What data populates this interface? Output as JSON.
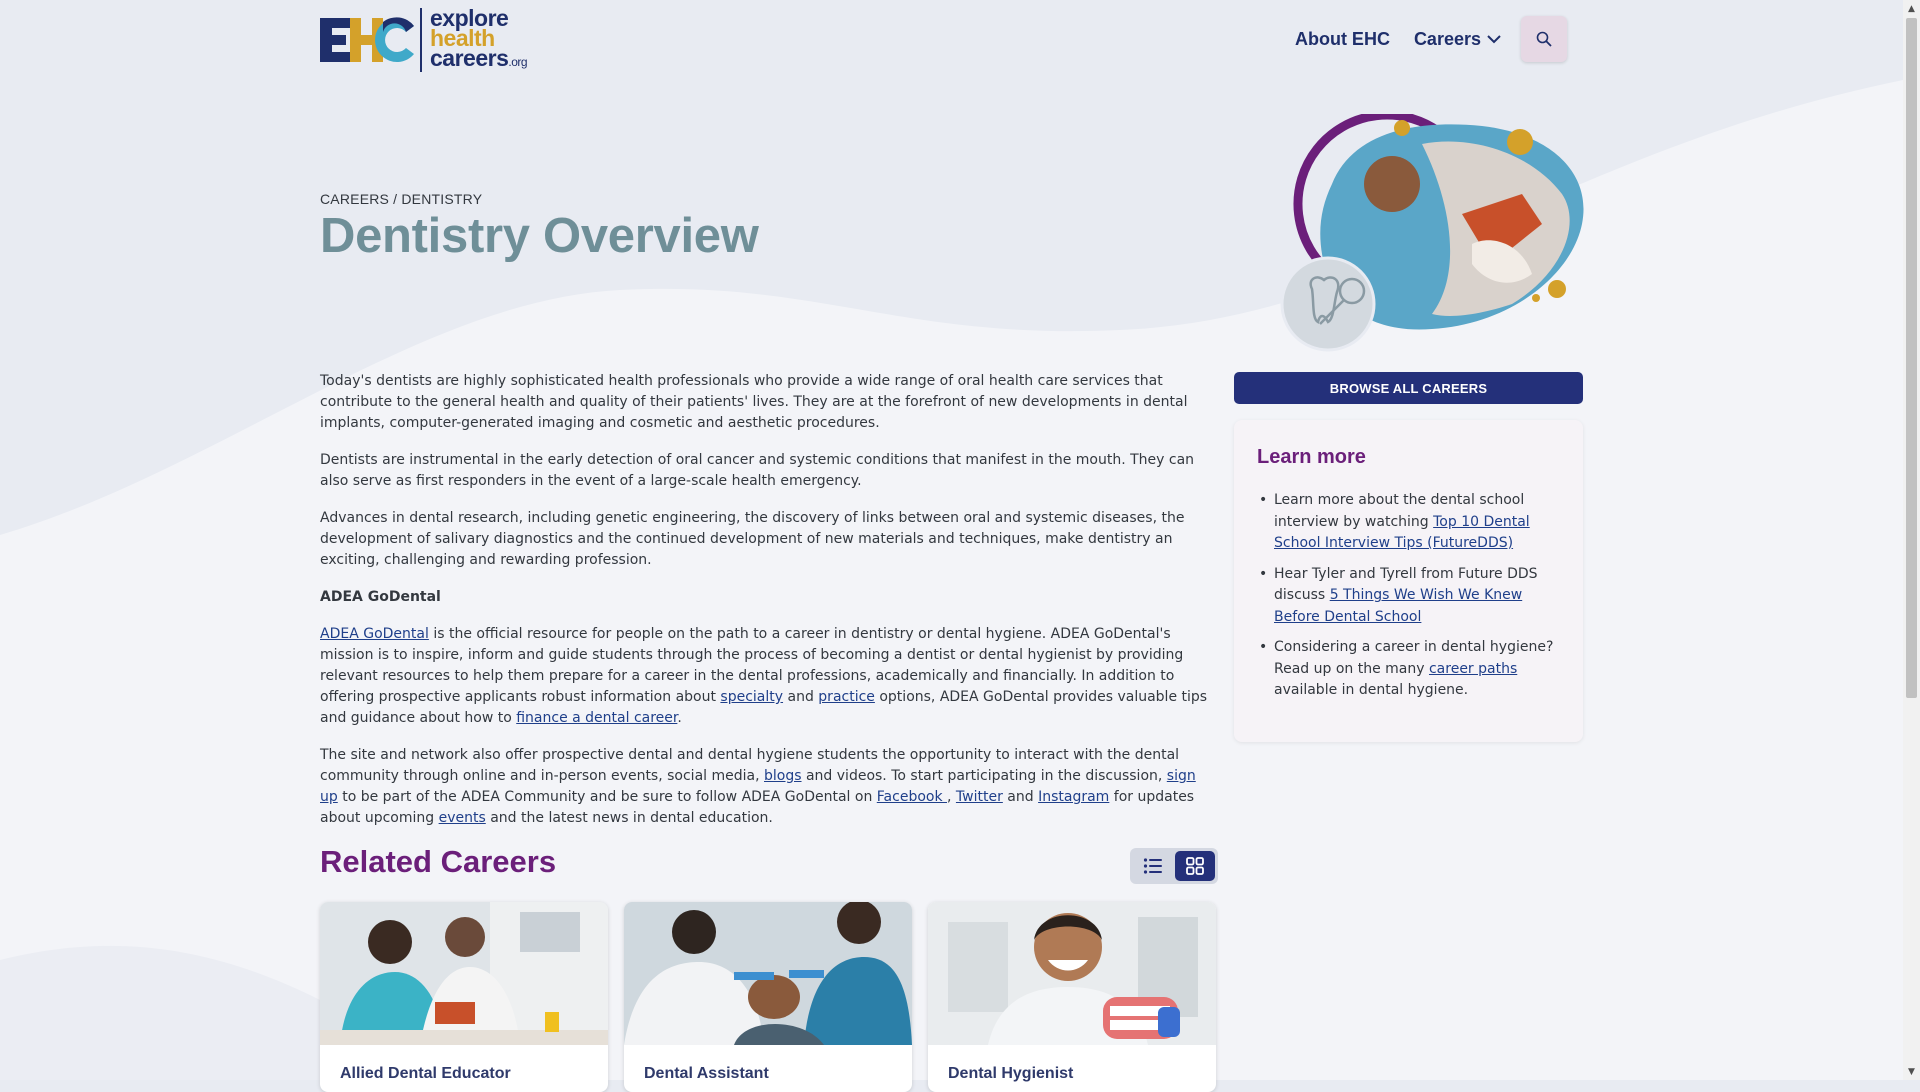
{
  "header": {
    "logo": {
      "mark": "EHC",
      "line1": "explore",
      "line2": "health",
      "line3": "careers",
      "org": ".org"
    },
    "nav": {
      "about": "About EHC",
      "careers": "Careers"
    },
    "search_icon": "search-icon"
  },
  "hero": {
    "breadcrumb": "CAREERS / DENTISTRY",
    "title": "Dentistry Overview"
  },
  "main": {
    "p1": "Today's dentists are highly sophisticated health professionals who provide a wide range of oral health care services that contribute to the general health and quality of their patients' lives. They are at the forefront of new developments in dental implants, computer-generated imaging and cosmetic and aesthetic procedures.",
    "p2": "Dentists are instrumental in the early detection of oral cancer and systemic conditions that manifest in the mouth. They can also serve as first responders in the event of a large-scale health emergency.",
    "p3": "Advances in dental research, including genetic engineering, the discovery of links between oral and systemic diseases, the development of salivary diagnostics and the continued development of new materials and techniques, make dentistry an exciting, challenging and rewarding profession.",
    "subheading": "ADEA GoDental",
    "p4": {
      "link1": "ADEA GoDental",
      "t1": " is the official resource for people on the path to a career in dentistry or dental hygiene. ADEA GoDental's mission is to inspire, inform and guide students through the process of becoming a dentist or dental hygienist by providing relevant resources to help them prepare for a career in the dental professions, academically and financially. In addition to offering prospective applicants robust information about ",
      "link2": "specialty",
      "t2": " and ",
      "link3": "practice",
      "t3": " options, ADEA GoDental provides valuable tips and guidance about how to ",
      "link4": "finance a dental career",
      "t4": "."
    },
    "p5": {
      "t1": "The site and network also offer prospective dental and dental hygiene students the opportunity to interact with the dental community through online and in-person events, social media, ",
      "link1": "blogs",
      "t2": " and videos. To start participating in the discussion, ",
      "link2": "sign up",
      "t3": " to be part of the ADEA Community and be sure to follow ADEA GoDental on ",
      "link3": "Facebook ",
      "t4": ", ",
      "link4": "Twitter",
      "t5": " and ",
      "link5": "Instagram",
      "t6": " for updates about upcoming ",
      "link6": "events",
      "t7": " and the latest news in dental education."
    }
  },
  "related": {
    "title": "Related Careers",
    "list_view_icon": "list-view-icon",
    "grid_view_icon": "grid-view-icon",
    "cards": [
      {
        "title": "Allied Dental Educator"
      },
      {
        "title": "Dental Assistant"
      },
      {
        "title": "Dental Hygienist"
      }
    ]
  },
  "sidebar": {
    "browse_label": "BROWSE ALL CAREERS",
    "learn_title": "Learn more",
    "items": [
      {
        "text": "Learn more about the dental school interview by watching ",
        "link": "Top 10 Dental School Interview Tips (FutureDDS)",
        "after": ""
      },
      {
        "text": "Hear Tyler and Tyrell from Future DDS discuss ",
        "link": "5 Things We Wish We Knew Before Dental School",
        "after": ""
      },
      {
        "text": "Considering a career in dental hygiene? Read up on the many ",
        "link": "career paths",
        "after": " available in dental hygiene."
      }
    ]
  },
  "colors": {
    "navy": "#1f2f6b",
    "purple": "#6b1f7a",
    "gold": "#d4a12a",
    "title_teal": "#6f8f98",
    "button": "#24307a"
  }
}
